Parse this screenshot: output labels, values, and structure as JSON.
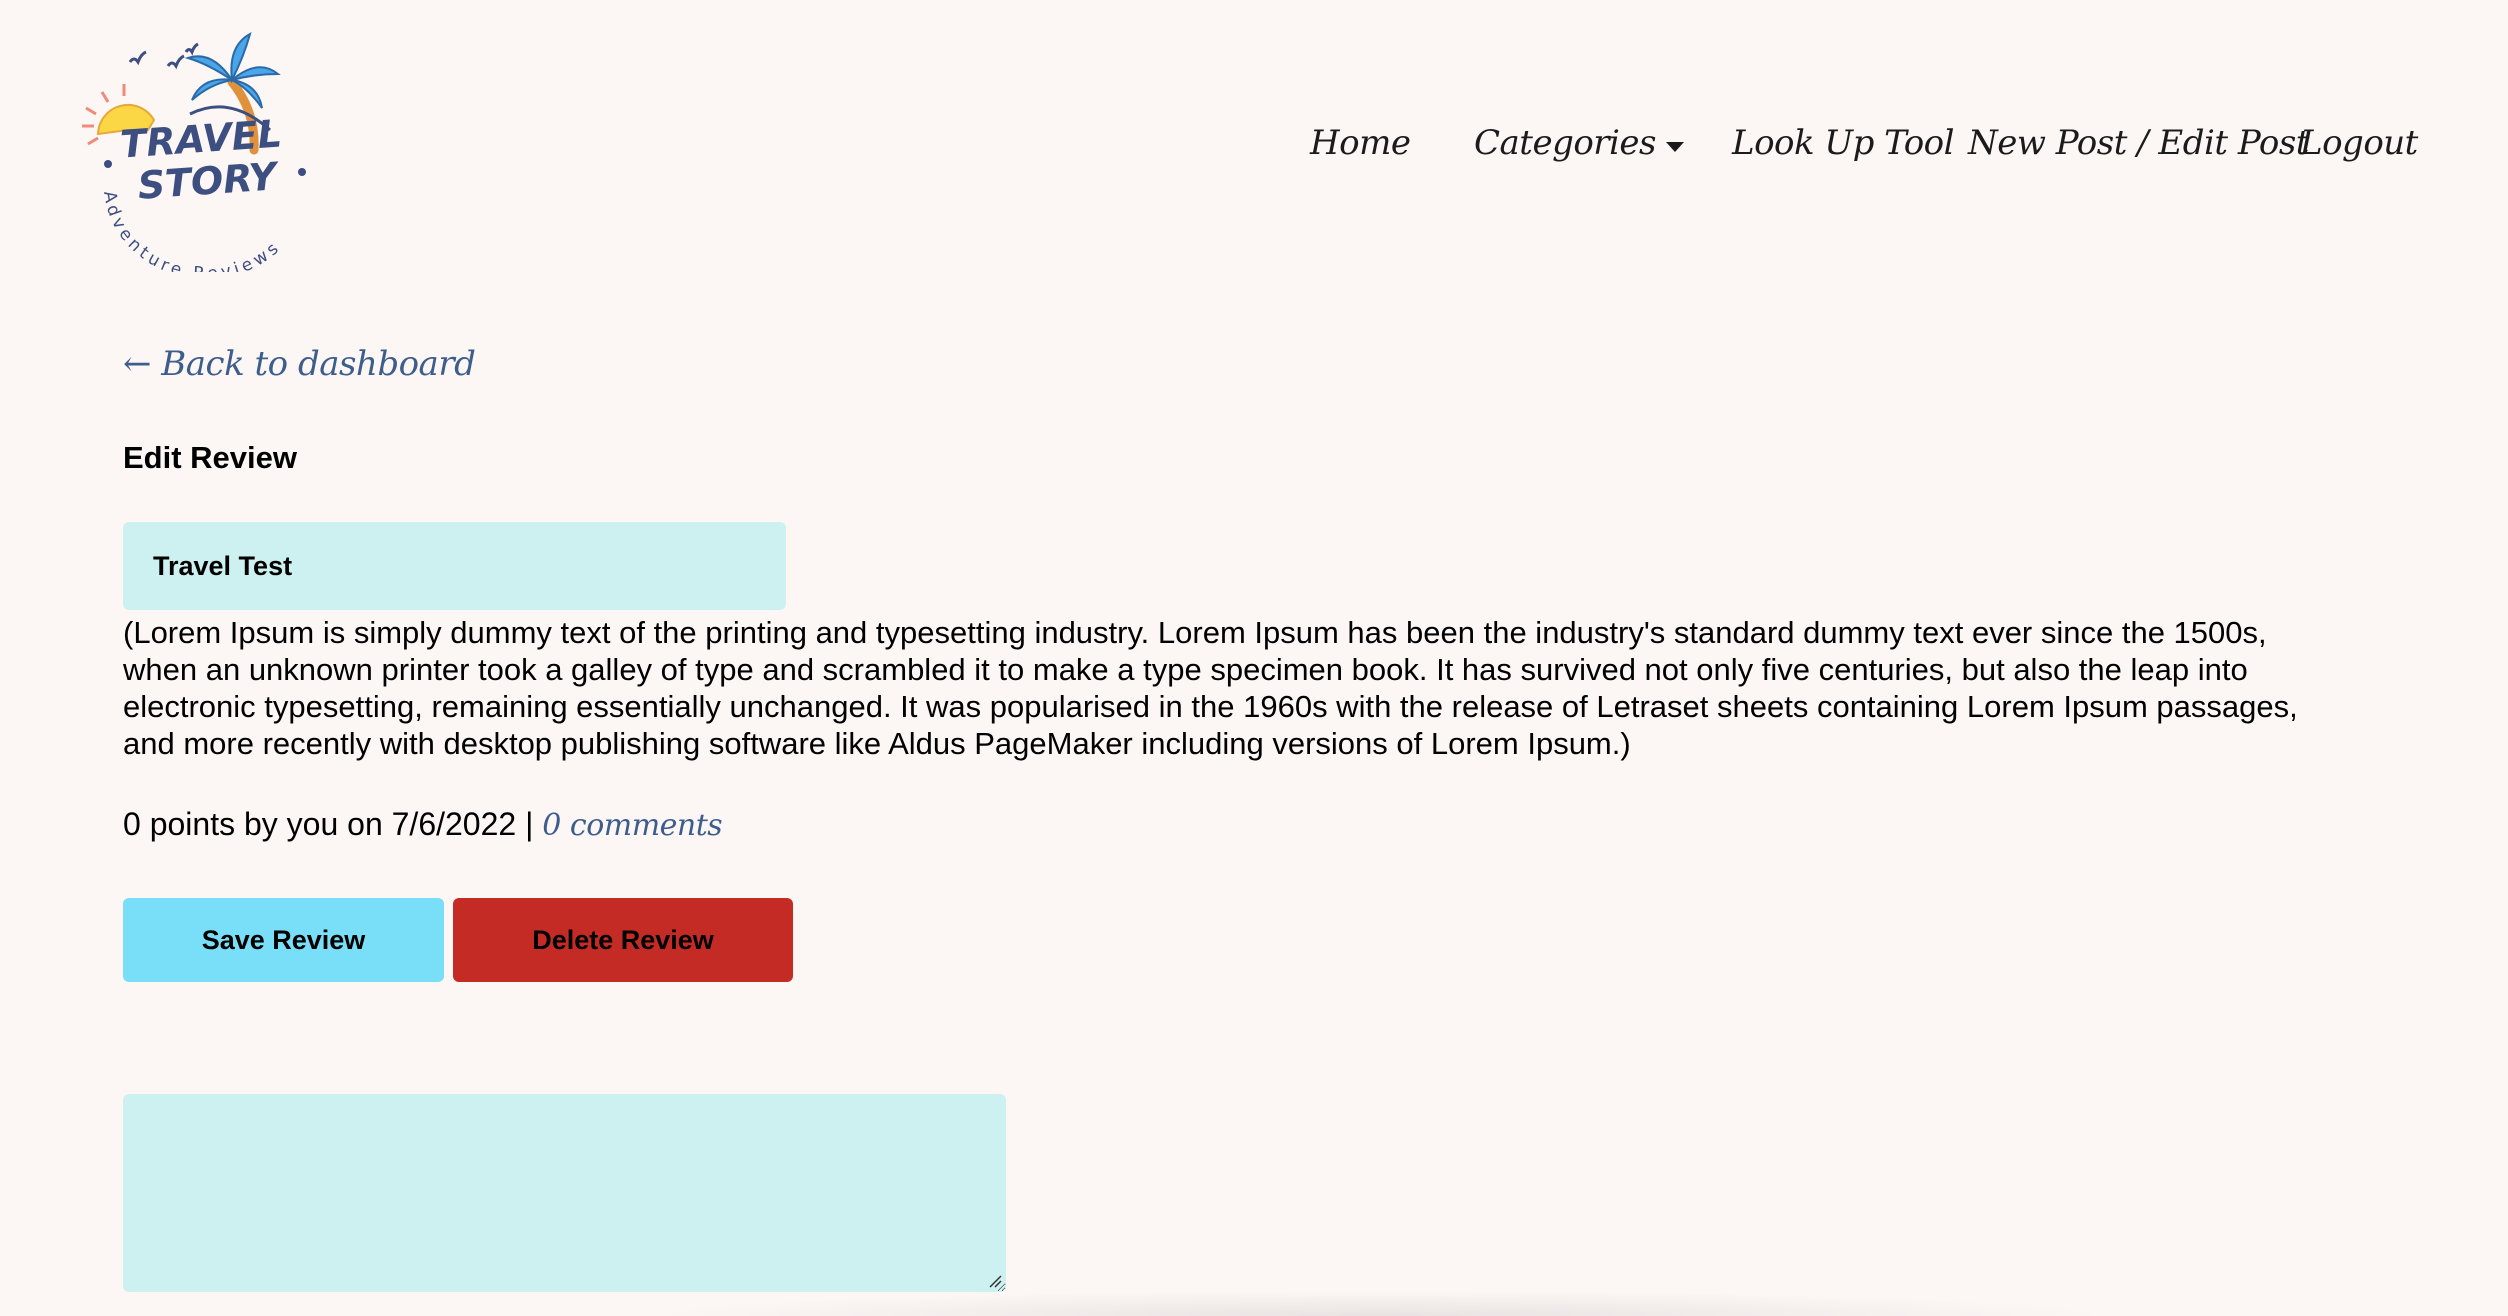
{
  "logo": {
    "line1": "TRAVEL",
    "line2": "STORY",
    "tagline": "Adventure Reviews"
  },
  "nav": {
    "items": [
      {
        "label": "Home"
      },
      {
        "label": "Categories"
      },
      {
        "label": "Look Up Tool"
      },
      {
        "label": "New Post / Edit Post"
      },
      {
        "label": "Logout"
      }
    ]
  },
  "back_link": {
    "label": "← Back to dashboard"
  },
  "page_title": "Edit Review",
  "form": {
    "title_value": "Travel Test",
    "body": "(Lorem Ipsum is simply dummy text of the printing and typesetting industry. Lorem Ipsum has been the industry's standard dummy text ever since the 1500s, when an unknown printer took a galley of type and scrambled it to make a type specimen book. It has survived not only five centuries, but also the leap into electronic typesetting, remaining essentially unchanged. It was popularised in the 1960s with the release of Letraset sheets containing Lorem Ipsum passages, and more recently with desktop publishing software like Aldus PageMaker including versions of Lorem Ipsum.)",
    "meta_text": "0 points by you on 7/6/2022 | ",
    "comments_link": "0 comments",
    "save_label": "Save Review",
    "delete_label": "Delete Review",
    "comment_value": ""
  },
  "colors": {
    "background": "#fcf6f5",
    "input_bg": "#ccf1f0",
    "save_button": "#79def7",
    "delete_button": "#c42b25",
    "link": "#3d5e8c"
  }
}
